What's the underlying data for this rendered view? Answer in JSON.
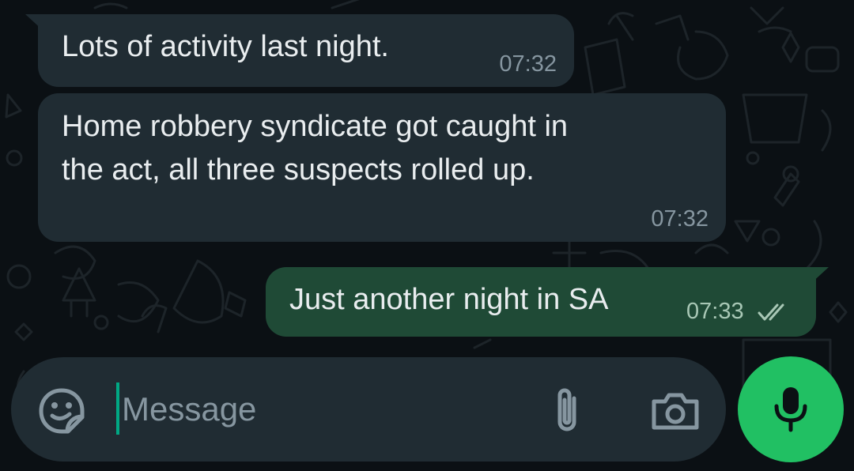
{
  "messages": [
    {
      "direction": "incoming",
      "text": "Lots of activity last night.",
      "time": "07:32"
    },
    {
      "direction": "incoming",
      "lines": [
        "Home robbery syndicate got caught in",
        "the act, all three suspects rolled up."
      ],
      "time": "07:32"
    },
    {
      "direction": "outgoing",
      "text": "Just another night in SA",
      "time": "07:33",
      "status_icon": "double-check-icon"
    }
  ],
  "composer": {
    "placeholder": "Message",
    "value": "",
    "sticker_icon": "sticker-icon",
    "attach_icon": "paperclip-icon",
    "camera_icon": "camera-icon",
    "mic_icon": "microphone-icon"
  },
  "colors": {
    "background": "#0b1014",
    "incoming_bubble": "#202c33",
    "outgoing_bubble": "#1f4a36",
    "text": "#e9edef",
    "timestamp": "#8696a0",
    "accent": "#00a884",
    "mic_button": "#21c063"
  }
}
